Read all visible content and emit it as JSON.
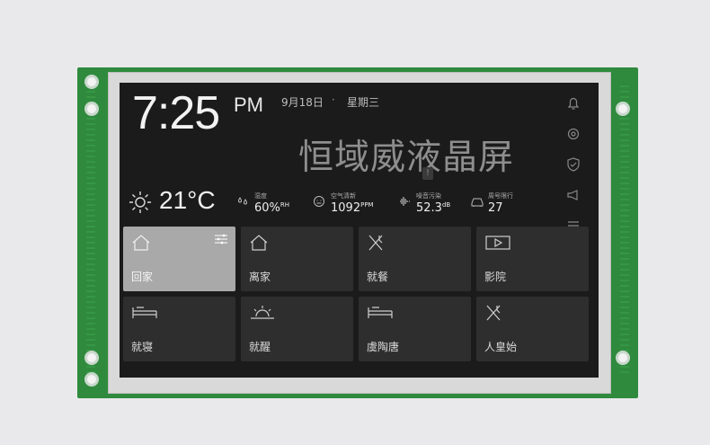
{
  "clock": {
    "time": "7:25",
    "ampm": "PM"
  },
  "date": {
    "date": "9月18日",
    "separator": "·",
    "weekday": "星期三"
  },
  "watermark": "恒域威液晶屏",
  "weather": {
    "temperature": "21°C",
    "icon": "sun-icon"
  },
  "stats": [
    {
      "label": "湿度",
      "value": "60%",
      "unit": "RH",
      "icon": "humidity-icon"
    },
    {
      "label": "空气清新",
      "value": "1092",
      "unit": "PPM",
      "icon": "air-quality-icon"
    },
    {
      "label": "噪音污染",
      "value": "52.3",
      "unit": "dB",
      "icon": "noise-icon"
    },
    {
      "label": "周号限行",
      "value": "27",
      "unit": "",
      "icon": "car-icon"
    }
  ],
  "side_icons": [
    "bell-icon",
    "gear-icon",
    "shield-icon",
    "megaphone-icon",
    "menu-icon"
  ],
  "tiles": [
    {
      "label": "回家",
      "icon": "home-icon",
      "active": true
    },
    {
      "label": "离家",
      "icon": "home-icon",
      "active": false
    },
    {
      "label": "就餐",
      "icon": "utensils-icon",
      "active": false
    },
    {
      "label": "影院",
      "icon": "play-icon",
      "active": false
    },
    {
      "label": "就寝",
      "icon": "bed-icon",
      "active": false
    },
    {
      "label": "就醒",
      "icon": "sunrise-icon",
      "active": false
    },
    {
      "label": "虞陶唐",
      "icon": "bed-icon",
      "active": false
    },
    {
      "label": "人皇始",
      "icon": "utensils-icon",
      "active": false
    }
  ]
}
